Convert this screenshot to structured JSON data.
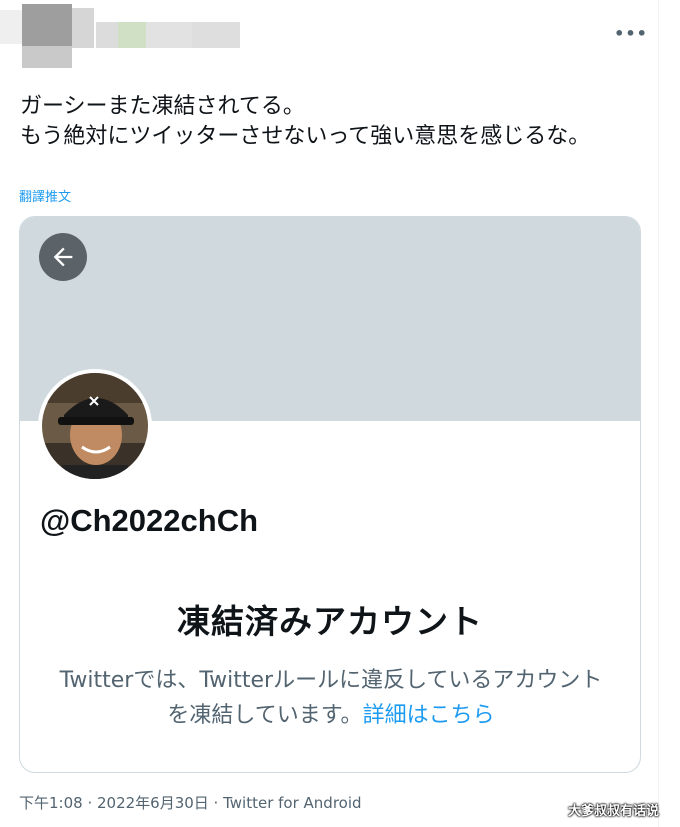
{
  "header": {
    "more_icon": "more-horizontal-icon",
    "more_label": "•••"
  },
  "tweet": {
    "text": "ガーシーまた凍結されてる。\nもう絶対にツイッターさせないって強い意思を感じるな。",
    "translate_label": "翻譯推文",
    "timestamp": "下午1:08 · 2022年6月30日 · Twitter for Android"
  },
  "card": {
    "back_icon": "arrow-left-icon",
    "handle": "@Ch2022chCh",
    "suspended_title": "凍結済みアカウント",
    "suspended_description": "Twitterでは、Twitterルールに違反しているアカウントを凍結しています。",
    "details_link": "詳細はこちら"
  },
  "watermark": {
    "text": "大爹叔叔有话说"
  },
  "colors": {
    "link": "#1d9bf0",
    "banner": "#cfd9de",
    "secondary_text": "#536471",
    "back_button": "#5b6369"
  }
}
